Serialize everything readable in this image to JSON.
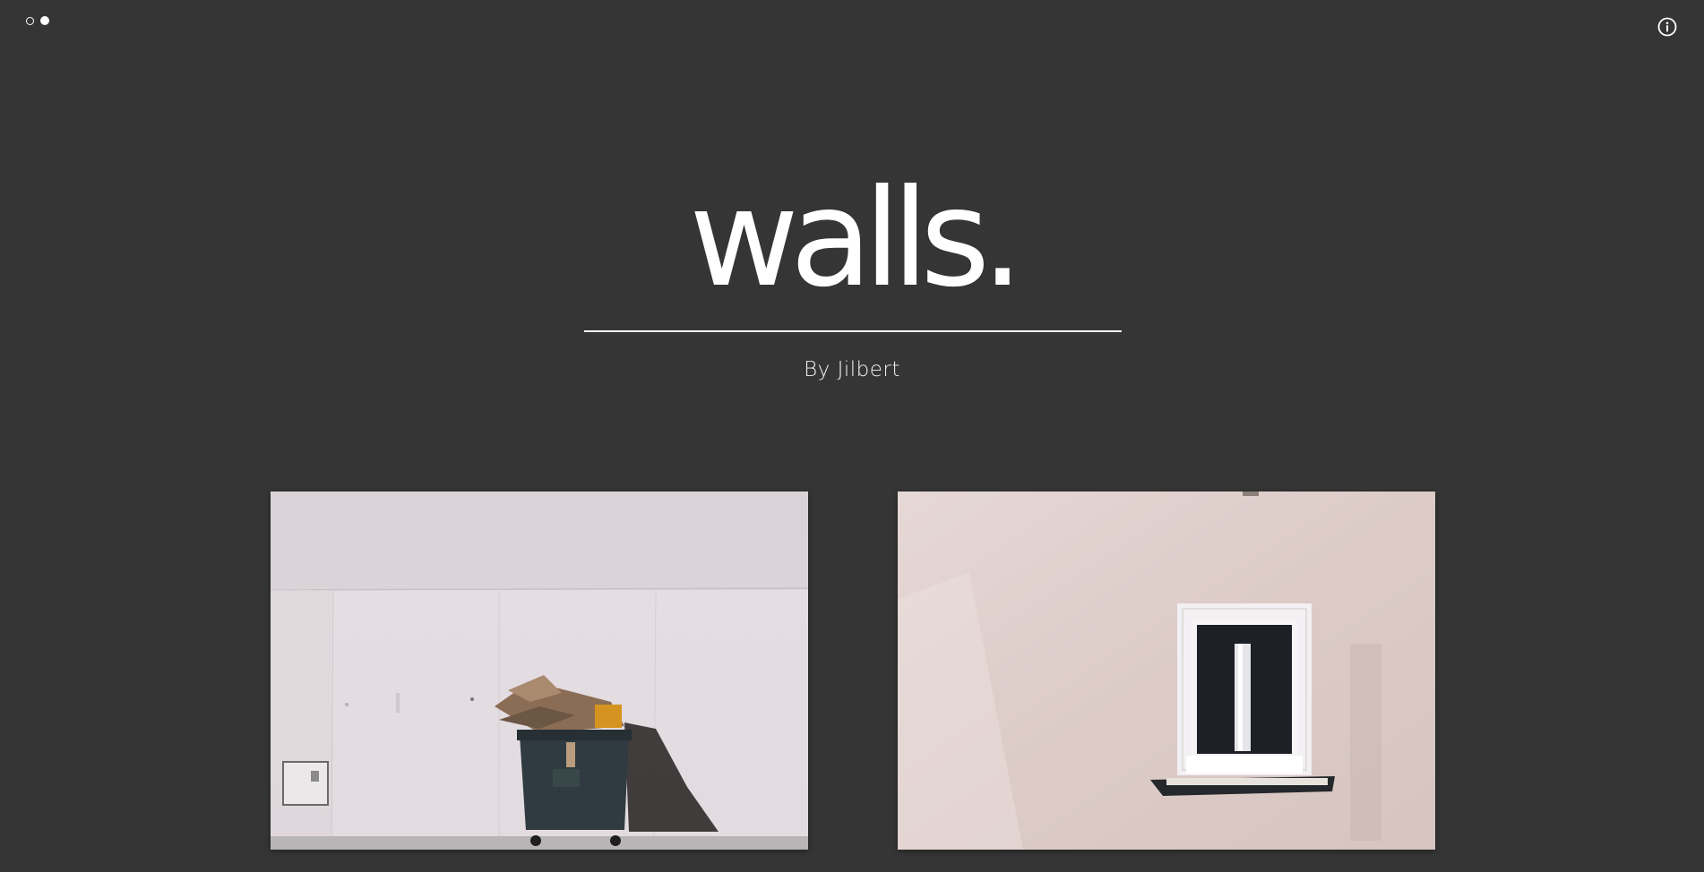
{
  "theme_toggle": {
    "options": [
      "light",
      "dark"
    ],
    "selected": "dark"
  },
  "header": {
    "logo_text": "walls.",
    "byline": "By Jilbert"
  },
  "info_button": {
    "icon": "info-icon"
  },
  "colors": {
    "background": "#353535",
    "foreground": "#ffffff"
  },
  "gallery": {
    "photos": [
      {
        "subject": "trash-bin-against-wall"
      },
      {
        "subject": "window-on-pink-wall"
      }
    ]
  }
}
